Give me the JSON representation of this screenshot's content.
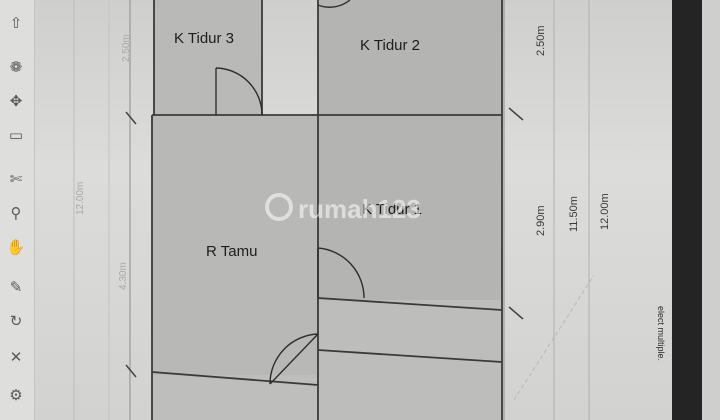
{
  "toolbar": {
    "tools": [
      {
        "name": "up-arrow-icon",
        "glyph": "⇧"
      },
      {
        "name": "orbit-icon",
        "glyph": "❁"
      },
      {
        "name": "walk-icon",
        "glyph": "✥"
      },
      {
        "name": "camera-icon",
        "glyph": "▭"
      },
      {
        "name": "measure-icon",
        "glyph": "✄"
      },
      {
        "name": "zoom-icon",
        "glyph": "⚲"
      },
      {
        "name": "pan-icon",
        "glyph": "✋"
      },
      {
        "name": "paint-icon",
        "glyph": "✎"
      },
      {
        "name": "rotate-icon",
        "glyph": "↻"
      },
      {
        "name": "cross-icon",
        "glyph": "✕"
      },
      {
        "name": "gear-icon",
        "glyph": "⚙"
      }
    ]
  },
  "plan": {
    "rooms": {
      "k_tidur_3": "K Tidur 3",
      "k_tidur_2": "K Tidur 2",
      "k_tidur_1": "K Tidur 1",
      "r_tamu": "R Tamu"
    },
    "dimensions": {
      "d1": "2.50m",
      "d2": "2.90m",
      "d3": "11.50m",
      "d4": "12.00m"
    },
    "faint_dimensions": {
      "f1": "2.50m",
      "f2": "12.00m",
      "f3": "4.30m"
    }
  },
  "watermark": "rumah123",
  "status_text": "elect multiple.",
  "colors": {
    "room_fill": "#bcbcba",
    "wall": "#3a3a3a",
    "watermark_accent": "#ffffff"
  }
}
